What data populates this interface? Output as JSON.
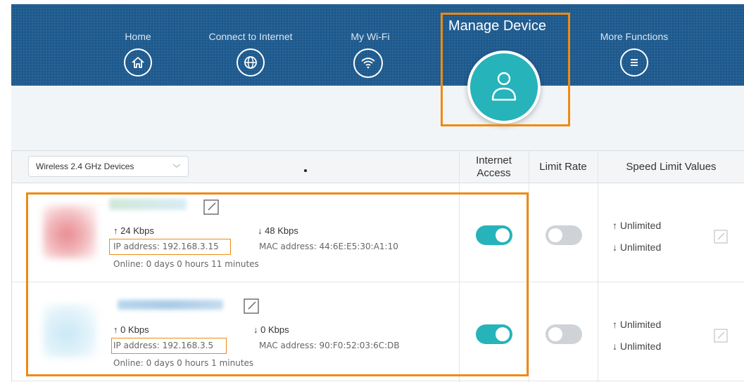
{
  "nav": {
    "items": [
      {
        "label": "Home",
        "icon": "home-icon"
      },
      {
        "label": "Connect to Internet",
        "icon": "globe-icon"
      },
      {
        "label": "My Wi-Fi",
        "icon": "wifi-icon"
      },
      {
        "label": "Manage Device",
        "icon": "user-icon",
        "active": true
      },
      {
        "label": "More Functions",
        "icon": "menu-icon"
      }
    ]
  },
  "filter": {
    "selected": "Wireless 2.4 GHz Devices"
  },
  "table": {
    "headers": {
      "internet_access": "Internet Access",
      "limit_rate": "Limit Rate",
      "speed_limit": "Speed Limit Values"
    },
    "rows": [
      {
        "up": "24 Kbps",
        "down": "48 Kbps",
        "ip": "IP address: 192.168.3.15",
        "mac": "MAC address: 44:6E:E5:30:A1:10",
        "online": "Online:  0 days 0 hours 11 minutes",
        "internet_access": true,
        "limit_rate": false,
        "limit_up": "Unlimited",
        "limit_down": "Unlimited"
      },
      {
        "up": "0 Kbps",
        "down": "0 Kbps",
        "ip": "IP address: 192.168.3.5",
        "mac": "MAC address: 90:F0:52:03:6C:DB",
        "online": "Online:  0 days 0 hours 1 minutes",
        "internet_access": true,
        "limit_rate": false,
        "limit_up": "Unlimited",
        "limit_down": "Unlimited"
      }
    ]
  },
  "colors": {
    "header_bg": "#1e5a8e",
    "accent": "#26b3ba",
    "highlight": "#f08a10"
  }
}
